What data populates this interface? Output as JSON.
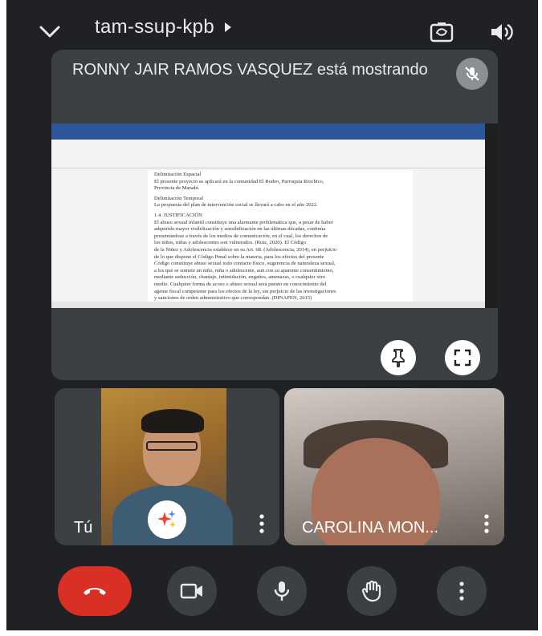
{
  "header": {
    "meeting_code": "tam-ssup-kpb",
    "icons": [
      "chevron-down-icon",
      "play-arrow-icon",
      "switch-camera-icon",
      "speaker-icon"
    ]
  },
  "presentation": {
    "presenter_label": "RONNY JAIR RAMOS VASQUEZ está mostrando",
    "document_lines": [
      "Delimitación Espacial",
      "El presente proyecto se aplicará en la comunidad El Rodeo, Parroquia Riochico,",
      "Provincia de Manabí.",
      "",
      "Delimitación Temporal",
      "La propuesta del plan de intervención social se llevará a cabo en el año 2022.",
      "",
      "1.4. JUSTIFICACIÓN",
      "El abuso sexual infantil constituye una alarmante problemática que, a pesar de haber",
      "adquirido mayor visibilización y sensibilización en las últimas décadas, continúa",
      "presentándose a través de los medios de comunicación, en el cual, los derechos de",
      "los niños, niñas y adolescentes son vulnerados. (Ruiz, 2020). El Código",
      "de la Niñez y Adolescencia establece en su Art. 68. (Adolescencia, 2014), en perjuicio",
      "de lo que dispone el Código Penal sobre la materia, para los efectos del presente",
      "Código constituye abuso sexual todo contacto físico, sugerencia de naturaleza sexual,",
      "a los que se somete un niño, niña o adolescente, aun con su aparente consentimiento,",
      "mediante seducción, chantaje, intimidación, engaños, amenazas, o cualquier otro",
      "medio. Cualquier forma de acoso o abuso sexual será puesto en conocimiento del",
      "agente fiscal competente para los efectos de la ley, sin perjuicio de las investigaciones",
      "y sanciones de orden administrativo que correspondan. (DINAPEN, 2015)"
    ]
  },
  "participants": [
    {
      "name": "Tú"
    },
    {
      "name": "CAROLINA MON..."
    }
  ],
  "controls": [
    "end-call",
    "camera",
    "microphone",
    "raise-hand",
    "more-options"
  ],
  "colors": {
    "background": "#202124",
    "tile": "#3c4043",
    "end_call": "#d93025",
    "text": "#e8eaed"
  }
}
